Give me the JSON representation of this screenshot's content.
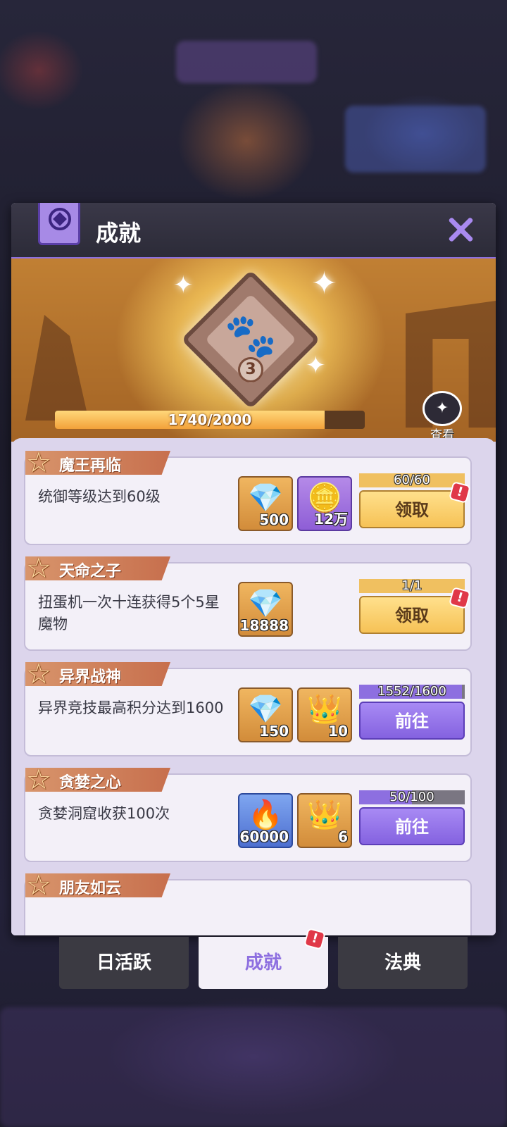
{
  "modal": {
    "title": "成就"
  },
  "banner": {
    "level": "3",
    "progress_text": "1740/2000",
    "progress_value": 1740,
    "progress_max": 2000,
    "view_label": "查看"
  },
  "achievements": [
    {
      "name": "魔王再临",
      "desc": "统御等级达到60级",
      "rewards": [
        {
          "icon": "crystal-icon",
          "count": "500"
        },
        {
          "icon": "silver-coin-icon",
          "count": "12万"
        }
      ],
      "progress_text": "60/60",
      "progress_fraction": 1.0,
      "button": "领取",
      "button_type": "claim",
      "alert": true
    },
    {
      "name": "天命之子",
      "desc": "扭蛋机一次十连获得5个5星魔物",
      "rewards": [
        {
          "icon": "crystal-icon",
          "count": "18888"
        }
      ],
      "progress_text": "1/1",
      "progress_fraction": 1.0,
      "button": "领取",
      "button_type": "claim",
      "alert": true
    },
    {
      "name": "异界战神",
      "desc": "异界竞技最高积分达到1600",
      "rewards": [
        {
          "icon": "crystal-icon",
          "count": "150"
        },
        {
          "icon": "crown-medal-icon",
          "count": "10"
        }
      ],
      "progress_text": "1552/1600",
      "progress_fraction": 0.97,
      "button": "前往",
      "button_type": "go",
      "alert": false
    },
    {
      "name": "贪婪之心",
      "desc": "贪婪洞窟收获100次",
      "rewards": [
        {
          "icon": "blue-flame-icon",
          "count": "60000"
        },
        {
          "icon": "crown-medal-icon",
          "count": "6"
        }
      ],
      "progress_text": "50/100",
      "progress_fraction": 0.5,
      "button": "前往",
      "button_type": "go",
      "alert": false
    },
    {
      "name": "朋友如云"
    }
  ],
  "tabs": [
    {
      "label": "日活跃",
      "active": false,
      "alert": false
    },
    {
      "label": "成就",
      "active": true,
      "alert": true
    },
    {
      "label": "法典",
      "active": false,
      "alert": false
    }
  ],
  "alert_symbol": "!"
}
